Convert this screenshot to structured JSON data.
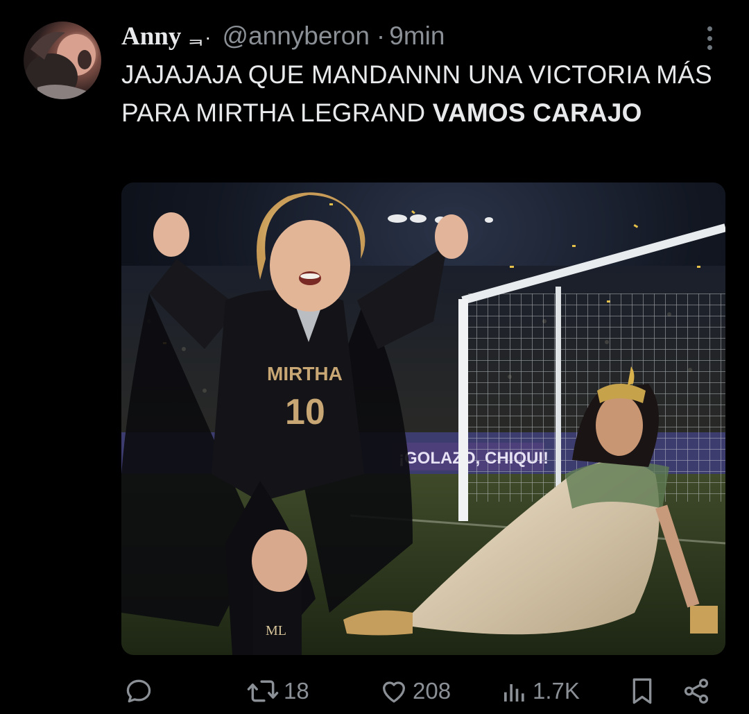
{
  "tweet": {
    "author_name": "Anny",
    "author_emoji": "ᆿ·",
    "handle": "@annyberon",
    "separator": "·",
    "time": "9min",
    "text_normal": "JAJAJAJA QUE MANDANNN UNA VICTORIA MÁS PARA MIRTHA LEGRAND ",
    "text_bold": "VAMOS CARAJO"
  },
  "media": {
    "jersey_name": "MIRTHA",
    "jersey_number": "10",
    "sock_initials": "ML",
    "banner_text": "¡GOLAZO, CHIQUI!"
  },
  "actions": {
    "reply_icon": "reply-icon",
    "retweet_icon": "retweet-icon",
    "retweets": "18",
    "like_icon": "heart-icon",
    "likes": "208",
    "views_icon": "views-bar-chart-icon",
    "views": "1.7K",
    "bookmark_icon": "bookmark-icon",
    "share_icon": "share-icon"
  },
  "colors": {
    "background": "#000000",
    "text": "#e7e9ea",
    "muted": "#8b9096"
  }
}
